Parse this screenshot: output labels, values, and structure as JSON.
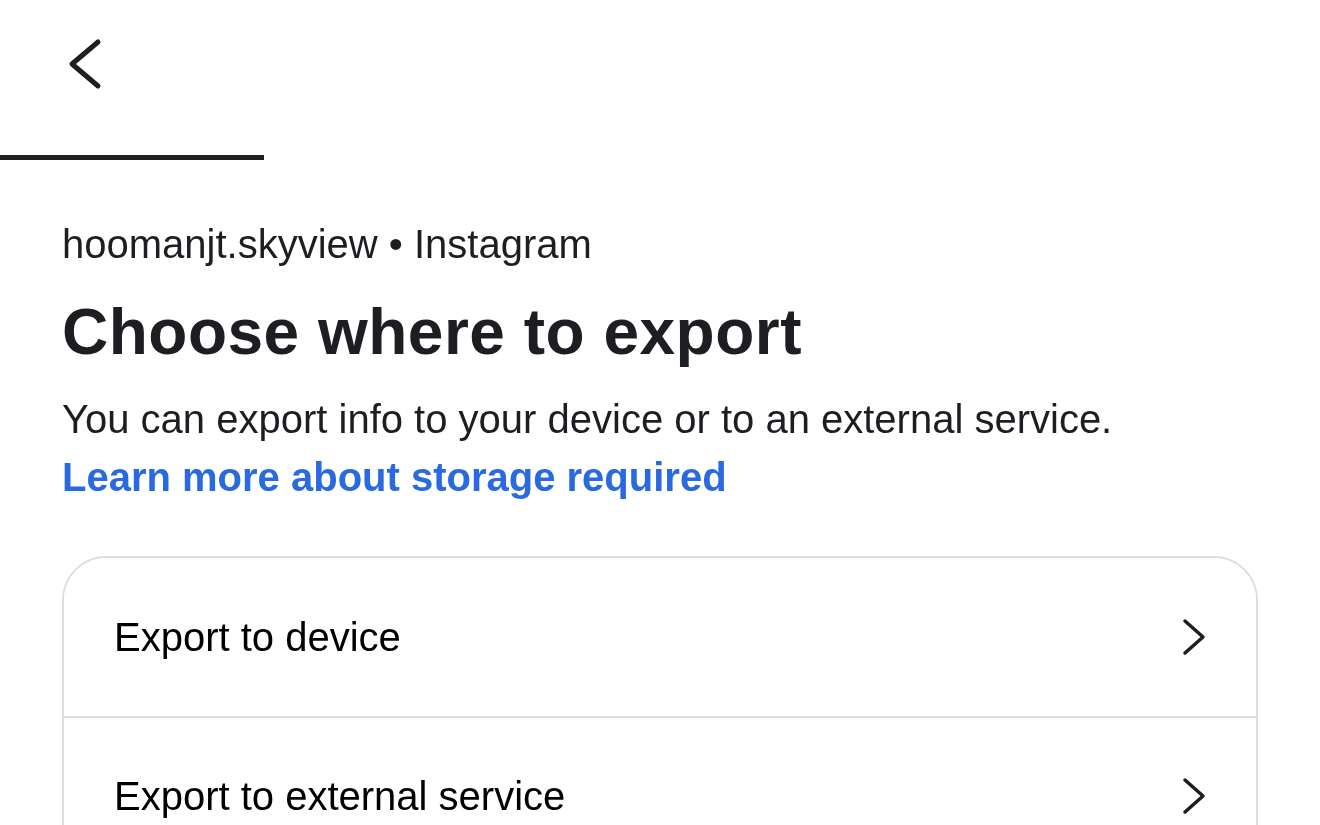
{
  "progress": {
    "level": 0.2
  },
  "account": "hoomanjt.skyview • Instagram",
  "title": "Choose where to export",
  "description": "You can export info to your device or to an external service.",
  "link": "Learn more about storage required",
  "options": [
    {
      "label": "Export to device"
    },
    {
      "label": "Export to external service"
    }
  ]
}
